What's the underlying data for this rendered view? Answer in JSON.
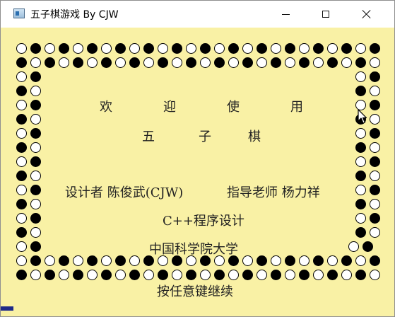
{
  "window": {
    "title": "五子棋游戏 By CJW",
    "icons": {
      "app": "app-icon",
      "minimize": "minimize-icon",
      "maximize": "maximize-icon",
      "close": "close-icon"
    }
  },
  "splash": {
    "welcome": [
      "欢",
      "迎",
      "使",
      "用"
    ],
    "game_name": [
      "五",
      "子",
      "棋"
    ],
    "designer": "设计者 陈俊武(CJW)",
    "advisor": "指导老师 杨力祥",
    "course": "C++程序设计",
    "university": "中国科学院大学",
    "prompt": "按任意键继续"
  },
  "colors": {
    "background": "#f9f1a5",
    "black_stone": "#000000",
    "white_stone": "#ffffff"
  }
}
